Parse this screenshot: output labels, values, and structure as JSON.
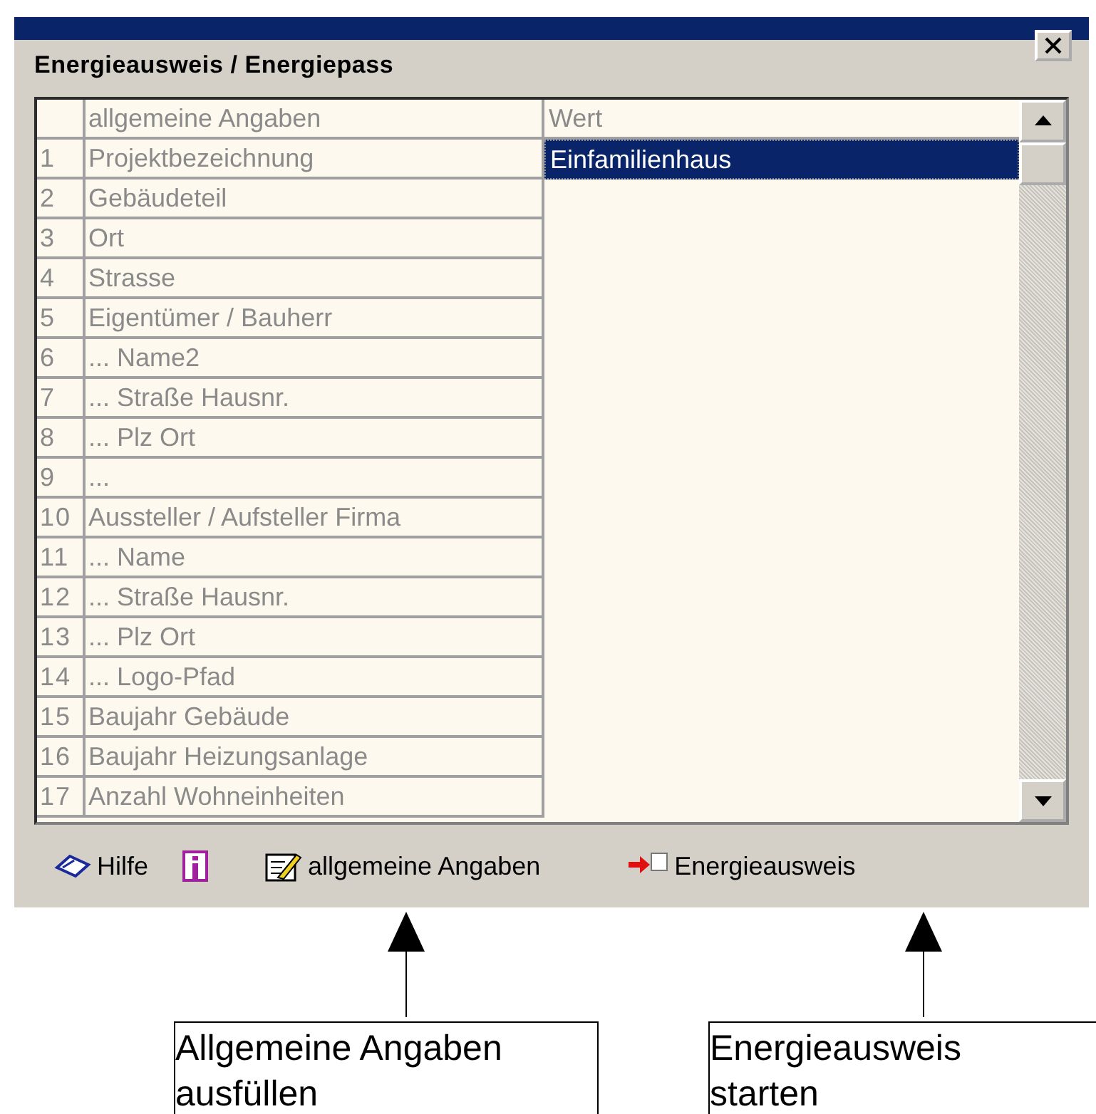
{
  "window": {
    "title": "Energieausweis / Energiepass"
  },
  "table": {
    "columns": [
      "allgemeine Angaben",
      "Wert"
    ],
    "rows": [
      {
        "number": "1",
        "label": "Projektbezeichnung",
        "value": "Einfamilienhaus",
        "selected": true
      },
      {
        "number": "2",
        "label": "Gebäudeteil",
        "selected": false
      },
      {
        "number": "3",
        "label": "Ort",
        "selected": false
      },
      {
        "number": "4",
        "label": "Strasse",
        "selected": false
      },
      {
        "number": "5",
        "label": "Eigentümer / Bauherr",
        "selected": false
      },
      {
        "number": "6",
        "label": "... Name2",
        "selected": false
      },
      {
        "number": "7",
        "label": "... Straße Hausnr.",
        "selected": false
      },
      {
        "number": "8",
        "label": "... Plz Ort",
        "selected": false
      },
      {
        "number": "9",
        "label": "...",
        "selected": false
      },
      {
        "number": "10",
        "label": "Aussteller / Aufsteller Firma",
        "selected": false
      },
      {
        "number": "11",
        "label": "... Name",
        "selected": false
      },
      {
        "number": "12",
        "label": "... Straße Hausnr.",
        "selected": false
      },
      {
        "number": "13",
        "label": "... Plz Ort",
        "selected": false
      },
      {
        "number": "14",
        "label": "... Logo-Pfad",
        "selected": false
      },
      {
        "number": "15",
        "label": "Baujahr Gebäude",
        "selected": false
      },
      {
        "number": "16",
        "label": "Baujahr Heizungsanlage",
        "selected": false
      },
      {
        "number": "17",
        "label": "Anzahl Wohneinheiten",
        "selected": false
      }
    ]
  },
  "toolbar": [
    {
      "kind": "help",
      "label": "Hilfe"
    },
    {
      "kind": "info"
    },
    {
      "kind": "edit",
      "label": "allgemeine Angaben"
    },
    {
      "kind": "start",
      "label": "Energieausweis"
    }
  ],
  "callouts": [
    {
      "text": "Allgemeine Angaben ausfüllen"
    },
    {
      "text": "Energieausweis starten"
    }
  ]
}
